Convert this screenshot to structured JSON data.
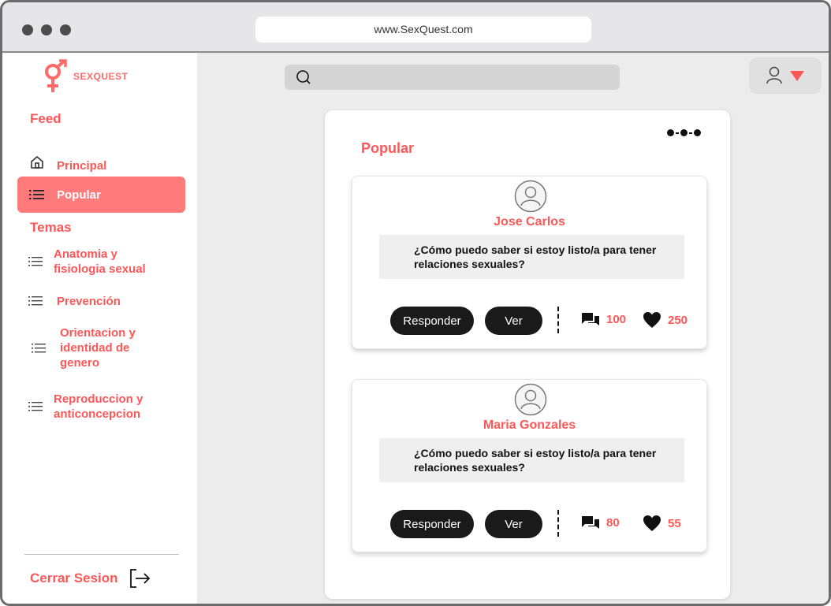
{
  "browser": {
    "url": "www.SexQuest.com"
  },
  "brand": {
    "name": "SEXQUEST",
    "logo_icon": "gender-symbol-icon",
    "accent_color": "#ff5757"
  },
  "sidebar": {
    "feed_title": "Feed",
    "feed_items": [
      {
        "label": "Principal",
        "icon": "home-icon",
        "active": false
      },
      {
        "label": "Popular",
        "icon": "list-icon",
        "active": true
      }
    ],
    "topics_title": "Temas",
    "topic_items": [
      {
        "label": "Anatomia y fisiologia sexual",
        "icon": "list-icon"
      },
      {
        "label": "Prevención",
        "icon": "list-icon"
      },
      {
        "label": "Orientacion y identidad de genero",
        "icon": "list-icon"
      },
      {
        "label": "Reproduccion y anticoncepcion",
        "icon": "list-icon"
      }
    ],
    "logout_label": "Cerrar Sesion"
  },
  "header": {
    "search_placeholder": ""
  },
  "main": {
    "title": "Popular",
    "posts": [
      {
        "author": "Jose Carlos",
        "question": "¿Cómo puedo saber si estoy listo/a para tener relaciones sexuales?",
        "reply_label": "Responder",
        "view_label": "Ver",
        "comments": "100",
        "likes": "250"
      },
      {
        "author": "Maria Gonzales",
        "question": "¿Cómo puedo saber si estoy listo/a para tener relaciones sexuales?",
        "reply_label": "Responder",
        "view_label": "Ver",
        "comments": "80",
        "likes": "55"
      }
    ]
  }
}
